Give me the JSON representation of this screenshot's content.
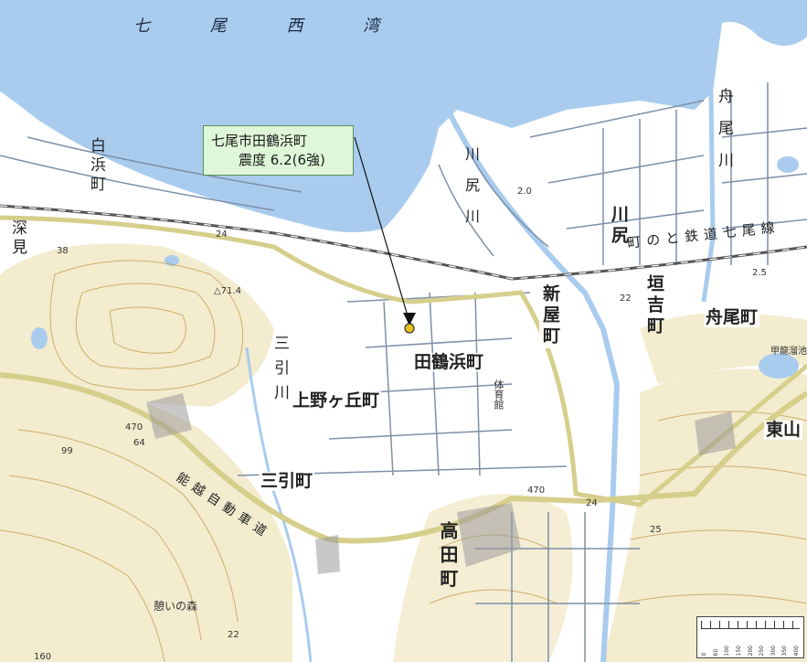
{
  "map": {
    "bay_name": "七 尾 西 湾",
    "callout": {
      "line1": "七尾市田鶴浜町",
      "line2": "震度 6.2(6強)"
    },
    "places": {
      "shirahama": "白浜町",
      "fukami": "深見",
      "kawashiri_vertical": "川尻川",
      "kawashiri_town": "川尻",
      "funao_river": "舟尾川",
      "shinyacho": "新屋町",
      "kakiyoshi": "垣吉町",
      "funao_town": "舟尾町",
      "tatsuruhama": "田鶴浜町",
      "uenogaoka": "上野ヶ丘町",
      "mihiki_river": "三引川",
      "mihiki_town": "三引町",
      "takada": "高田町",
      "higashiyama": "東山",
      "ikoinomori": "憩いの森",
      "gym": "体育館",
      "koryu": "甲龍溜池"
    },
    "rail_label": "町のと鉄道七尾線",
    "expressway": "能越自動車道",
    "route_24": "24",
    "route_470": "470",
    "spot_heights": [
      "△71.4",
      "38",
      "99",
      "64",
      "2.0",
      "22",
      "2.5",
      "22",
      "25",
      "160"
    ],
    "scale_ticks": [
      "0",
      "60",
      "100",
      "150",
      "200",
      "250",
      "300",
      "350",
      "400"
    ],
    "colors": {
      "water": "#a9ccee",
      "land": "#ffffff",
      "hills": "#f3eccf",
      "roads": "#7d8fa8",
      "expressway": "#d6ce8b",
      "contour": "#c49a4a",
      "callout_bg": "#dff7d9"
    }
  }
}
